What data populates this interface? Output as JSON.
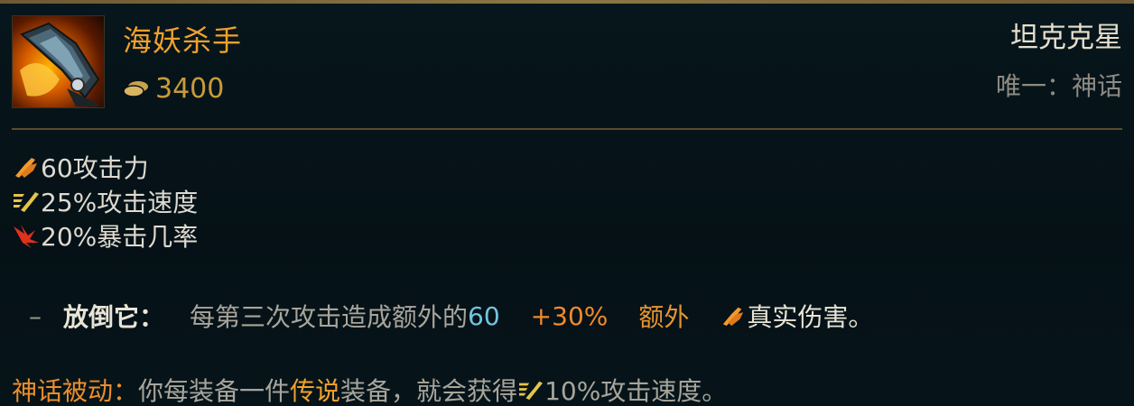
{
  "item": {
    "name": "海妖杀手",
    "cost": "3400",
    "category": "坦克克星",
    "uniqueness": "唯一：神话",
    "icon": "sword-gauntlet-item-icon"
  },
  "stats": [
    {
      "icon": "attack-damage-icon",
      "text": "60攻击力"
    },
    {
      "icon": "attack-speed-icon",
      "text": "25%攻击速度"
    },
    {
      "icon": "critical-strike-icon",
      "text": "20%暴击几率"
    }
  ],
  "passive": {
    "dash": "–",
    "name": "放倒它：",
    "desc_prefix": "每第三次攻击造成额外的",
    "base_value": "60",
    "ratio_value": "+30%",
    "bonus_label": "额外",
    "damage_type": "真实伤害",
    "period": "。"
  },
  "mythic": {
    "name": "神话被动：",
    "desc_prefix": "你每装备一件",
    "legend_word": "传说",
    "desc_middle": "装备，就会获得",
    "bonus": "10%攻击速度。"
  },
  "colors": {
    "gold": "#c79b3b",
    "name": "#f0a12c",
    "blue": "#6fc5de",
    "orange": "#f08a2c"
  }
}
